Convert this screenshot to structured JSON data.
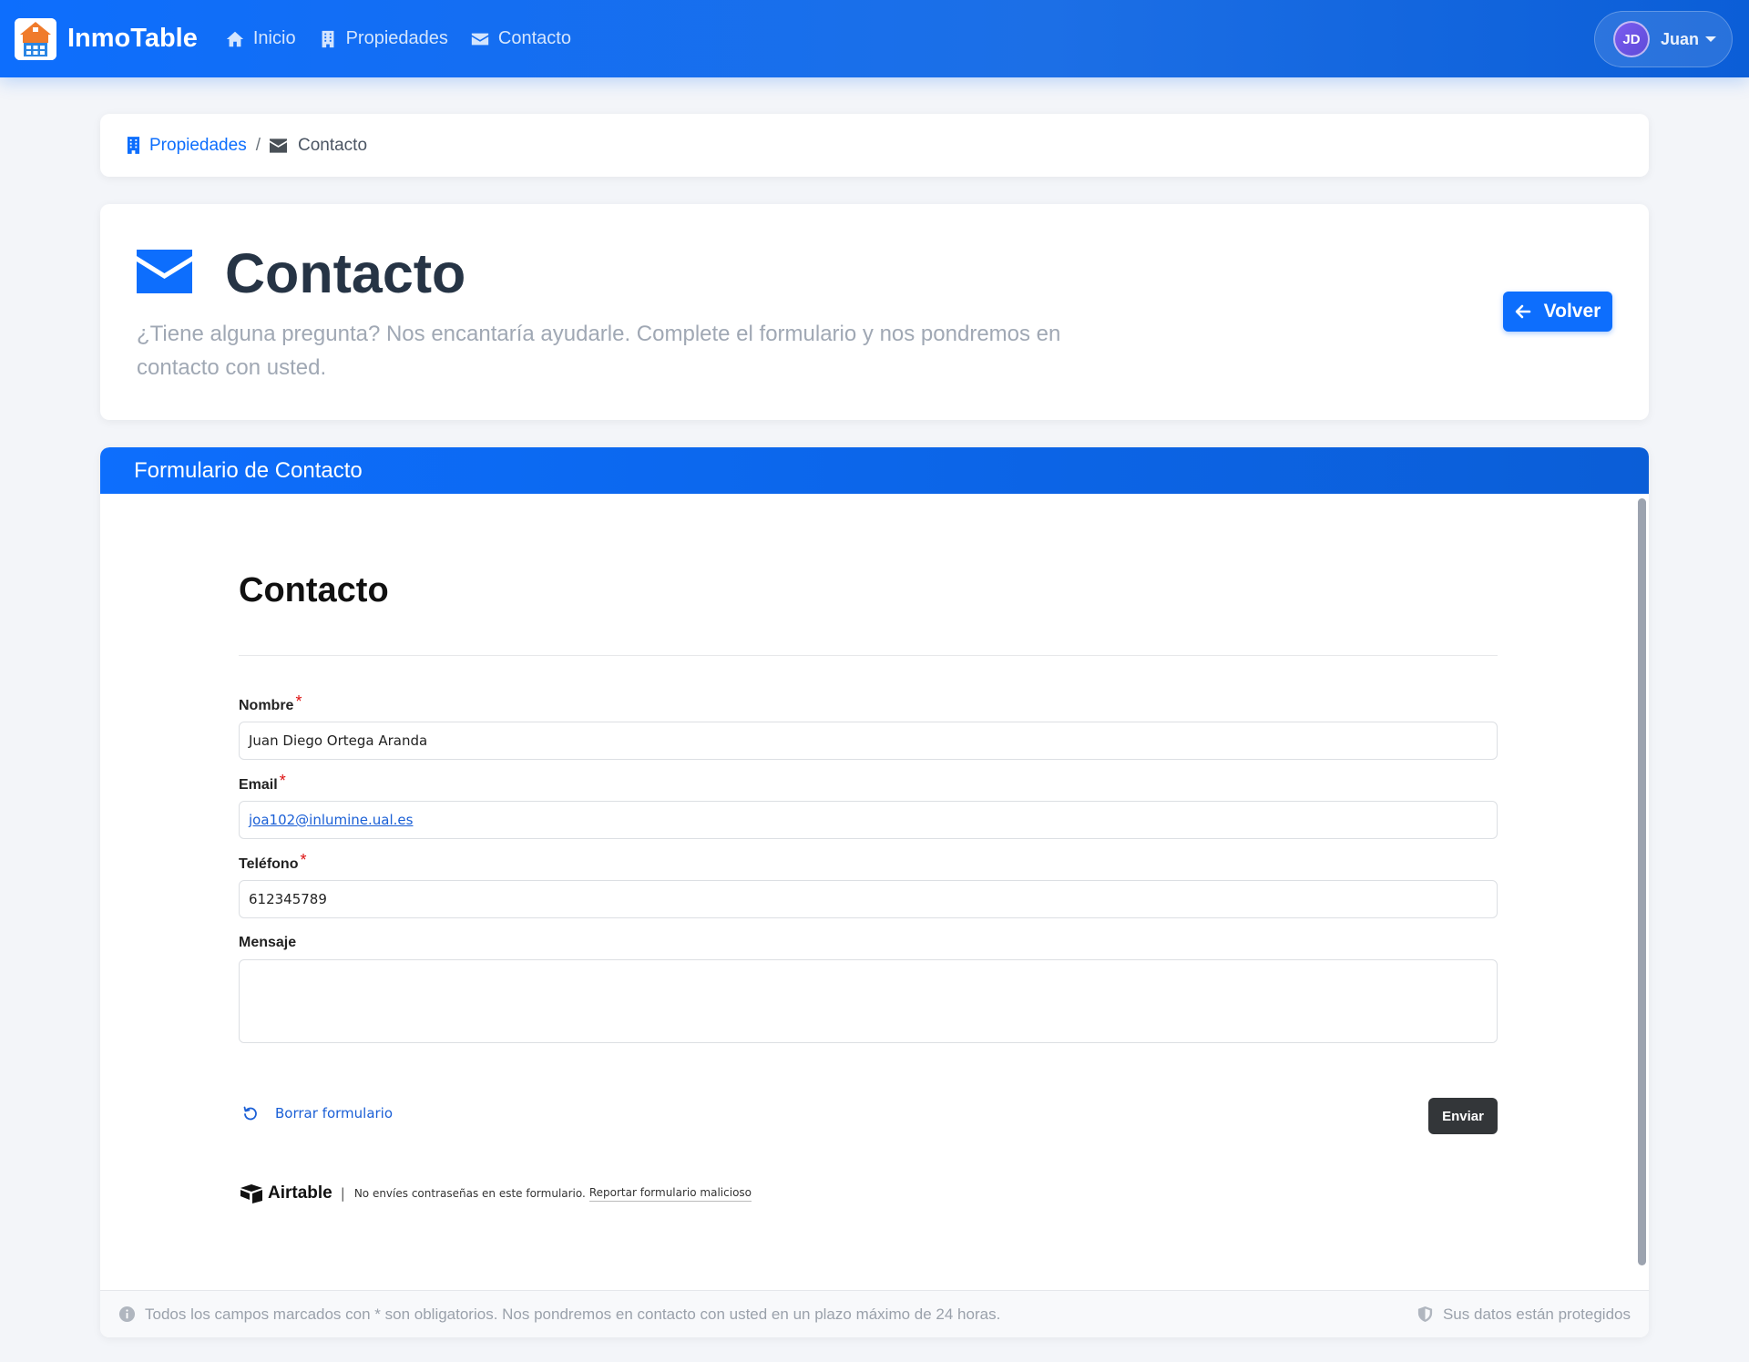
{
  "navbar": {
    "brand": "InmoTable",
    "links": [
      {
        "label": "Inicio",
        "icon": "home-icon"
      },
      {
        "label": "Propiedades",
        "icon": "building-icon"
      },
      {
        "label": "Contacto",
        "icon": "envelope-icon"
      }
    ],
    "user": {
      "initials": "JD",
      "name": "Juan"
    }
  },
  "breadcrumb": {
    "parent": "Propiedades",
    "separator": "/",
    "current": "Contacto"
  },
  "header": {
    "title": "Contacto",
    "subtitle": "¿Tiene alguna pregunta? Nos encantaría ayudarle. Complete el formulario y nos pondremos en contacto con usted.",
    "back_label": "Volver"
  },
  "form_card": {
    "header": "Formulario de Contacto",
    "footer_note": "Todos los campos marcados con * son obligatorios. Nos pondremos en contacto con usted en un plazo máximo de 24 horas.",
    "footer_secure": "Sus datos están protegidos"
  },
  "airtable_form": {
    "title": "Contacto",
    "fields": {
      "nombre": {
        "label": "Nombre",
        "required_mark": "*",
        "value": "Juan Diego Ortega Aranda"
      },
      "email": {
        "label": "Email",
        "required_mark": "*",
        "value": "joa102@inlumine.ual.es"
      },
      "telefono": {
        "label": "Teléfono",
        "required_mark": "*",
        "value": "612345789"
      },
      "mensaje": {
        "label": "Mensaje",
        "value": ""
      }
    },
    "reset_label": "Borrar formulario",
    "submit_label": "Enviar",
    "brand": "Airtable",
    "pipe": "|",
    "disclaimer": "No envíes contraseñas en este formulario.",
    "report_label": "Reportar formulario malicioso"
  },
  "colors": {
    "primary": "#0d6efd",
    "title_text": "#263445",
    "muted_text": "#a0a8b4",
    "submit_bg": "#333639",
    "required": "#dd1111"
  }
}
